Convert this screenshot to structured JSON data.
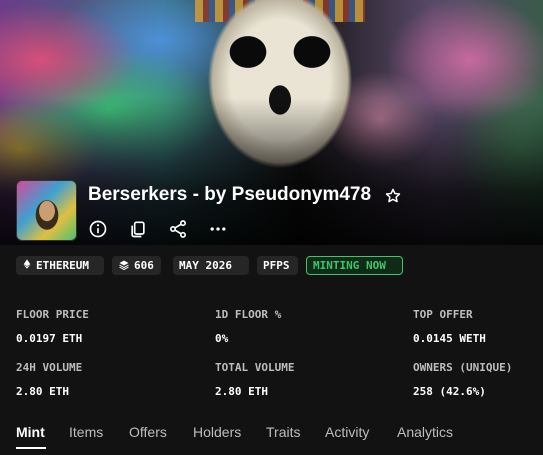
{
  "collection": {
    "title": "Berserkers - by Pseudonym478"
  },
  "icons": {
    "favorite": "star-icon",
    "info": "info-icon",
    "copy": "copy-icon",
    "share": "share-icon",
    "more": "more-icon",
    "chain": "ethereum-icon",
    "supply": "layers-icon"
  },
  "badges": {
    "chain": "ETHEREUM",
    "supply": "606",
    "date": "MAY 2026",
    "category": "PFPS",
    "status": "MINTING NOW"
  },
  "stats": [
    {
      "label": "FLOOR PRICE",
      "value": "0.0197 ETH"
    },
    {
      "label": "1D FLOOR %",
      "value": "0%"
    },
    {
      "label": "TOP OFFER",
      "value": "0.0145 WETH"
    },
    {
      "label": "24H VOLUME",
      "value": "2.80 ETH"
    },
    {
      "label": "TOTAL VOLUME",
      "value": "2.80 ETH"
    },
    {
      "label": "OWNERS (UNIQUE)",
      "value": "258 (42.6%)"
    }
  ],
  "tabs": [
    "Mint",
    "Items",
    "Offers",
    "Holders",
    "Traits",
    "Activity",
    "Analytics"
  ],
  "colors": {
    "background": "#121212",
    "minting_green": "#3fc46b",
    "badge_bg": "#262626"
  }
}
